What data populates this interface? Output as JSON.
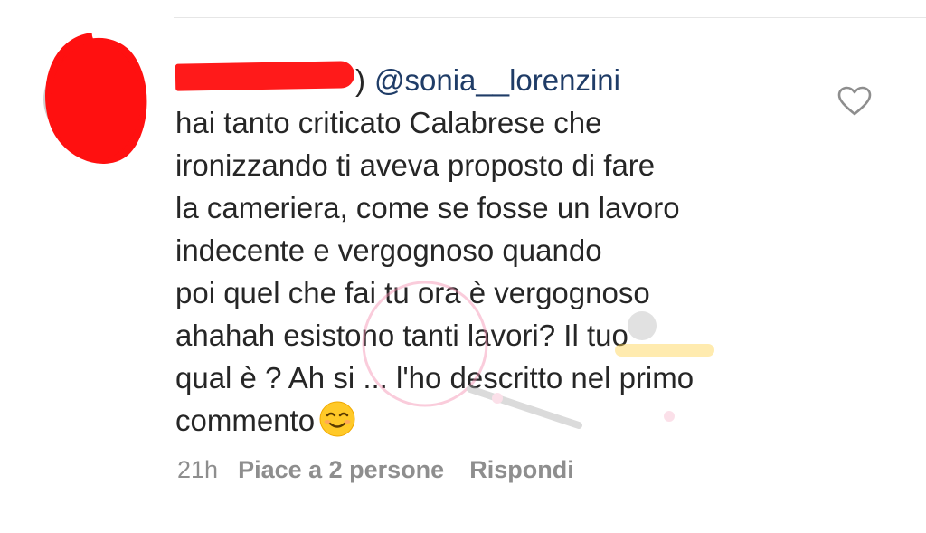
{
  "comment": {
    "author_mention": "@sonia__lorenzini",
    "body_lines": [
      "hai tanto criticato Calabrese che",
      "ironizzando ti aveva proposto di fare",
      "la cameriera, come se fosse un lavoro",
      "indecente e vergognoso quando",
      "poi quel che fai tu ora è vergognoso",
      "ahahah  esistono tanti lavori? Il tuo",
      "qual è ? Ah si ... l'ho descritto nel primo",
      "commento"
    ],
    "emoji": "smiling-face-emoji"
  },
  "meta": {
    "time": "21h",
    "likes": "Piace a 2 persone",
    "reply": "Rispondi"
  },
  "icons": {
    "like": "heart-outline-icon"
  },
  "colors": {
    "text": "#262626",
    "mention": "#1f3c67",
    "meta": "#8e8e8e",
    "redaction": "#ff1a1a"
  }
}
